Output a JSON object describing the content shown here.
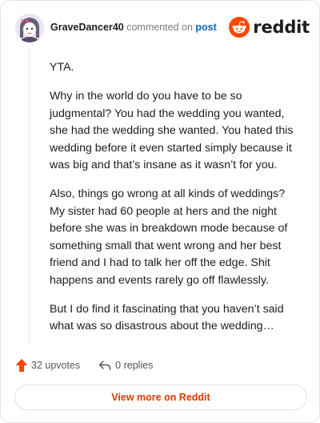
{
  "header": {
    "username": "GraveDancer40",
    "action_text": "commented on",
    "post_link": "post",
    "brand_wordmark": "reddit"
  },
  "comment": {
    "paragraphs": [
      "YTA.",
      "Why in the world do you have to be so judgmental? You had the wedding you wanted, she had the wedding she wanted. You hated this wedding before it even started simply because it was big and that’s insane as it wasn’t for you.",
      "Also, things go wrong at all kinds of weddings? My sister had 60 people at hers and the night before she was in breakdown mode because of something small that went wrong and her best friend and I had to talk her off the edge. Shit happens and events rarely go off flawlessly.",
      "But I do find it fascinating that you haven’t said what was so disastrous about the wedding…"
    ]
  },
  "footer": {
    "upvotes_label": "32 upvotes",
    "replies_label": "0 replies",
    "upvote_icon": "upvote-arrow-icon",
    "reply_icon": "reply-arrow-icon"
  },
  "cta": {
    "view_more_label": "View more on Reddit"
  },
  "colors": {
    "brand_orange": "#ff4500",
    "link_blue": "#0a66c2",
    "cta_text": "#d93a00"
  }
}
